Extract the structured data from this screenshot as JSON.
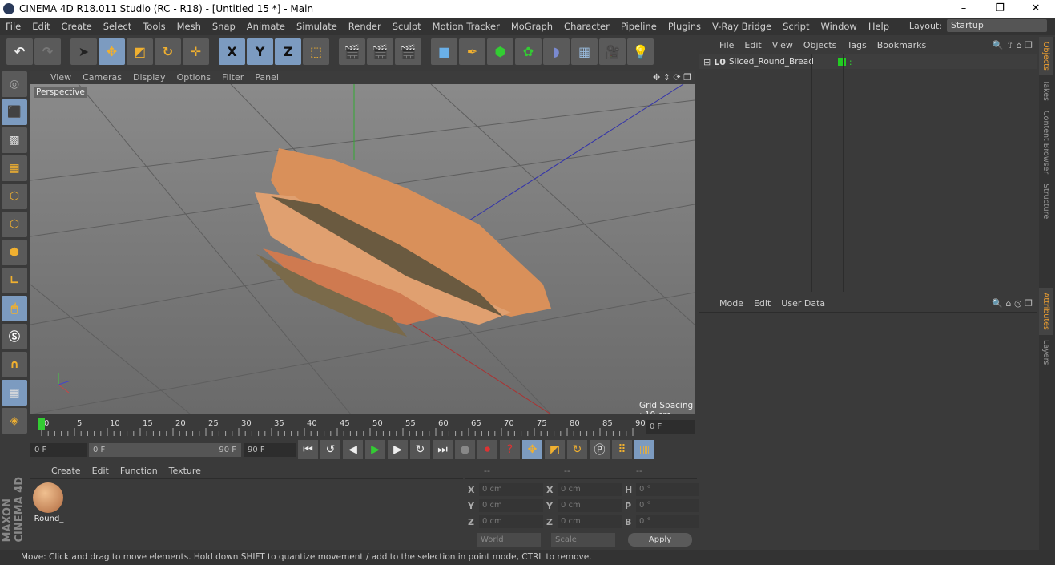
{
  "window": {
    "title": "CINEMA 4D R18.011 Studio (RC - R18) - [Untitled 15 *] - Main",
    "controls": [
      "–",
      "❐",
      "✕"
    ]
  },
  "menu": [
    "File",
    "Edit",
    "Create",
    "Select",
    "Tools",
    "Mesh",
    "Snap",
    "Animate",
    "Simulate",
    "Render",
    "Sculpt",
    "Motion Tracker",
    "MoGraph",
    "Character",
    "Pipeline",
    "Plugins",
    "V-Ray Bridge",
    "Script",
    "Window",
    "Help"
  ],
  "layout": {
    "label": "Layout:",
    "value": "Startup"
  },
  "toolbar": {
    "x": "X",
    "y": "Y",
    "z": "Z"
  },
  "viewport": {
    "menu": [
      "View",
      "Cameras",
      "Display",
      "Options",
      "Filter",
      "Panel"
    ],
    "camera": "Perspective",
    "grid_spacing": "Grid Spacing : 10 cm"
  },
  "timeline": {
    "ticks": [
      "0",
      "5",
      "10",
      "15",
      "20",
      "25",
      "30",
      "35",
      "40",
      "45",
      "50",
      "55",
      "60",
      "65",
      "70",
      "75",
      "80",
      "85",
      "90"
    ],
    "current_frame": "0 F"
  },
  "controls": {
    "start": "0 F",
    "range_start": "0 F",
    "range_end": "90 F",
    "end": "90 F"
  },
  "materials": {
    "menu": [
      "Create",
      "Edit",
      "Function",
      "Texture"
    ],
    "items": [
      {
        "name": "Round_"
      }
    ]
  },
  "coordinates": {
    "headers": [
      "--",
      "--",
      "--"
    ],
    "rows": [
      {
        "l1": "X",
        "v1": "0 cm",
        "l2": "X",
        "v2": "0 cm",
        "l3": "H",
        "v3": "0 °"
      },
      {
        "l1": "Y",
        "v1": "0 cm",
        "l2": "Y",
        "v2": "0 cm",
        "l3": "P",
        "v3": "0 °"
      },
      {
        "l1": "Z",
        "v1": "0 cm",
        "l2": "Z",
        "v2": "0 cm",
        "l3": "B",
        "v3": "0 °"
      }
    ],
    "mode": "World",
    "type": "Scale",
    "apply": "Apply"
  },
  "objects": {
    "menu": [
      "File",
      "Edit",
      "View",
      "Objects",
      "Tags",
      "Bookmarks"
    ],
    "items": [
      {
        "name": "Sliced_Round_Bread",
        "color": "#22cc22"
      }
    ]
  },
  "attributes": {
    "menu": [
      "Mode",
      "Edit",
      "User Data"
    ]
  },
  "right_tabs": [
    "Objects",
    "Takes",
    "Content Browser",
    "Structure",
    "Attributes",
    "Layers"
  ],
  "brand": "MAXON CINEMA 4D",
  "status": "Move: Click and drag to move elements. Hold down SHIFT to quantize movement / add to the selection in point mode, CTRL to remove."
}
